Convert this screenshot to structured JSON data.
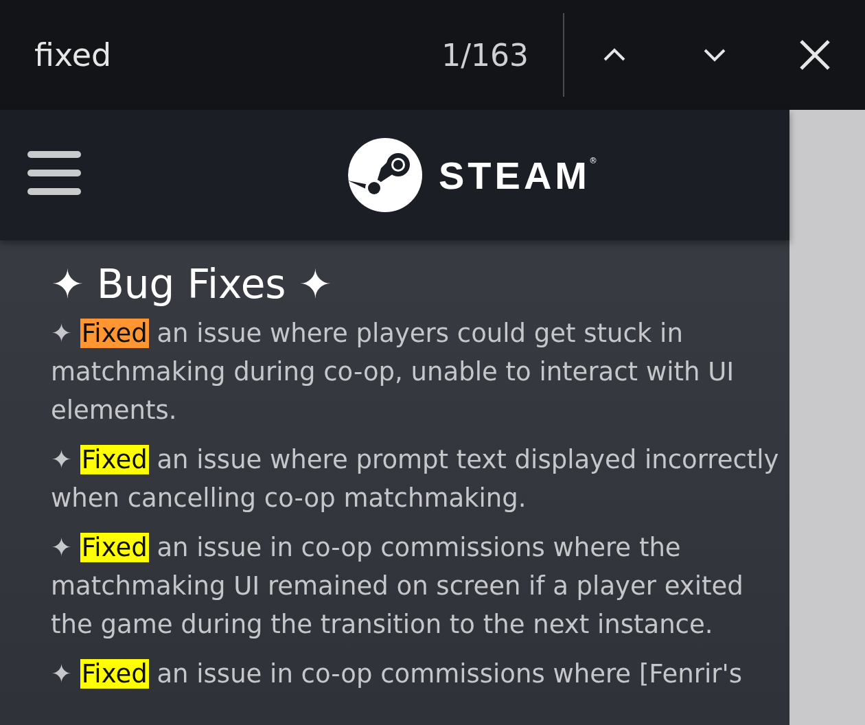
{
  "find_bar": {
    "query": "fixed",
    "match_count": "1/163"
  },
  "header": {
    "brand": "STEAM",
    "registered_mark": "®"
  },
  "section": {
    "heading": "✦ Bug Fixes ✦",
    "bullet": "✦",
    "items": [
      {
        "match": "Fixed",
        "current": true,
        "text": "an issue where players could get stuck in matchmaking during co-op, unable to interact with UI elements."
      },
      {
        "match": "Fixed",
        "current": false,
        "text": "an issue where prompt text displayed incorrectly when cancelling co-op matchmaking."
      },
      {
        "match": "Fixed",
        "current": false,
        "text": "an issue in co-op commissions where the matchmaking UI remained on screen if a player exited the game during the transition to the next instance."
      },
      {
        "match": "Fixed",
        "current": false,
        "text": "an issue in co-op commissions where [Fenrir's"
      }
    ]
  }
}
